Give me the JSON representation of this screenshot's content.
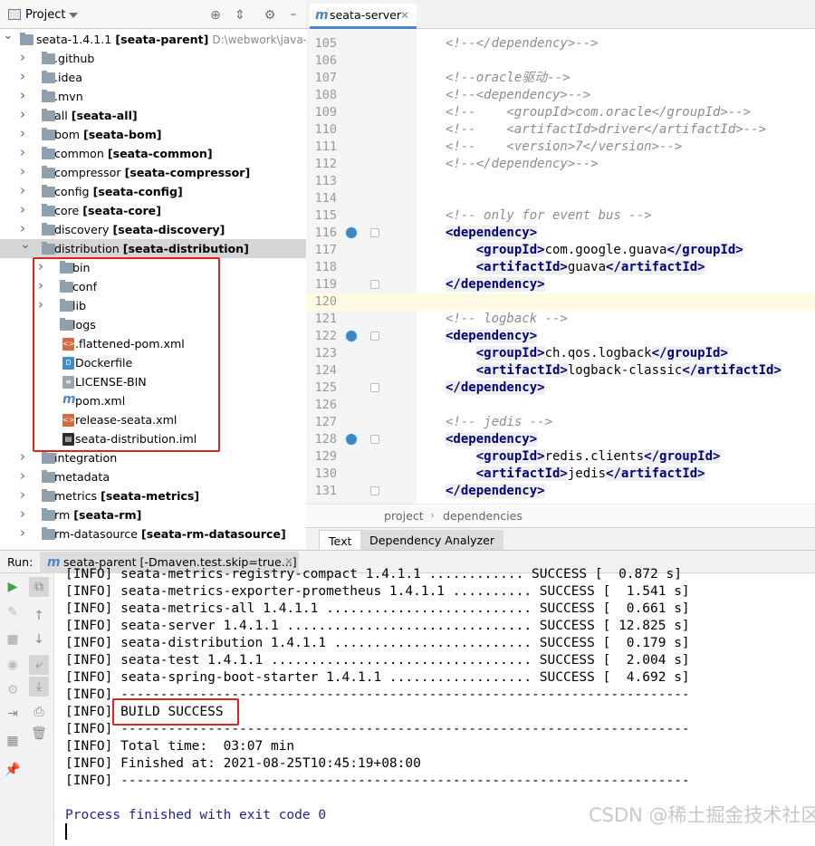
{
  "project": {
    "title": "Project",
    "root": {
      "name": "seata-1.4.1.1",
      "module": "[seata-parent]",
      "path": "D:\\webwork\\java-proj"
    },
    "items": [
      {
        "name": ".github",
        "module": ""
      },
      {
        "name": ".idea",
        "module": ""
      },
      {
        "name": ".mvn",
        "module": ""
      },
      {
        "name": "all",
        "module": "[seata-all]"
      },
      {
        "name": "bom",
        "module": "[seata-bom]"
      },
      {
        "name": "common",
        "module": "[seata-common]"
      },
      {
        "name": "compressor",
        "module": "[seata-compressor]"
      },
      {
        "name": "config",
        "module": "[seata-config]"
      },
      {
        "name": "core",
        "module": "[seata-core]"
      },
      {
        "name": "discovery",
        "module": "[seata-discovery]"
      },
      {
        "name": "distribution",
        "module": "[seata-distribution]"
      }
    ],
    "children": [
      {
        "name": "bin",
        "kind": "folder"
      },
      {
        "name": "conf",
        "kind": "folder"
      },
      {
        "name": "lib",
        "kind": "folder"
      },
      {
        "name": "logs",
        "kind": "folder"
      },
      {
        "name": ".flattened-pom.xml",
        "kind": "xml"
      },
      {
        "name": "Dockerfile",
        "kind": "docker"
      },
      {
        "name": "LICENSE-BIN",
        "kind": "text"
      },
      {
        "name": "pom.xml",
        "kind": "maven"
      },
      {
        "name": "release-seata.xml",
        "kind": "xml"
      },
      {
        "name": "seata-distribution.iml",
        "kind": "iml"
      }
    ],
    "after": [
      {
        "name": "integration",
        "module": ""
      },
      {
        "name": "metadata",
        "module": ""
      },
      {
        "name": "metrics",
        "module": "[seata-metrics]"
      },
      {
        "name": "rm",
        "module": "[seata-rm]"
      },
      {
        "name": "rm-datasource",
        "module": "[seata-rm-datasource]"
      }
    ]
  },
  "editor": {
    "tab": "seata-server",
    "tab_icon": "m",
    "lines": [
      {
        "n": "105",
        "t": "<!--</dependency>-->",
        "k": "cm"
      },
      {
        "n": "106",
        "t": "",
        "k": "cm"
      },
      {
        "n": "107",
        "t": "<!--oracle驱动-->",
        "k": "cm"
      },
      {
        "n": "108",
        "t": "<!--<dependency>-->",
        "k": "cm"
      },
      {
        "n": "109",
        "t": "<!--    <groupId>com.oracle</groupId>-->",
        "k": "cm"
      },
      {
        "n": "110",
        "t": "<!--    <artifactId>driver</artifactId>-->",
        "k": "cm"
      },
      {
        "n": "111",
        "t": "<!--    <version>7</version>-->",
        "k": "cm"
      },
      {
        "n": "112",
        "t": "<!--</dependency>-->",
        "k": "cm"
      },
      {
        "n": "113",
        "t": "",
        "k": "cm"
      },
      {
        "n": "114",
        "t": "",
        "k": "cm"
      },
      {
        "n": "115",
        "t": "<!-- only for event bus -->",
        "k": "cm"
      },
      {
        "n": "116",
        "t": "",
        "k": "dep-open"
      },
      {
        "n": "117",
        "t": "com.google.guava",
        "k": "groupId"
      },
      {
        "n": "118",
        "t": "guava",
        "k": "artifactId"
      },
      {
        "n": "119",
        "t": "",
        "k": "dep-close"
      },
      {
        "n": "120",
        "t": "",
        "k": "blank"
      },
      {
        "n": "121",
        "t": "<!-- logback -->",
        "k": "cm"
      },
      {
        "n": "122",
        "t": "",
        "k": "dep-open"
      },
      {
        "n": "123",
        "t": "ch.qos.logback",
        "k": "groupId"
      },
      {
        "n": "124",
        "t": "logback-classic",
        "k": "artifactId"
      },
      {
        "n": "125",
        "t": "",
        "k": "dep-close"
      },
      {
        "n": "126",
        "t": "",
        "k": "blank"
      },
      {
        "n": "127",
        "t": "<!-- jedis -->",
        "k": "cm"
      },
      {
        "n": "128",
        "t": "",
        "k": "dep-open"
      },
      {
        "n": "129",
        "t": "redis.clients",
        "k": "groupId"
      },
      {
        "n": "130",
        "t": "jedis",
        "k": "artifactId"
      },
      {
        "n": "131",
        "t": "",
        "k": "dep-close"
      }
    ],
    "breadcrumb": [
      "project",
      "dependencies"
    ],
    "bottom_tabs": [
      "Text",
      "Dependency Analyzer"
    ]
  },
  "run": {
    "label": "Run:",
    "tab": "seata-parent [-Dmaven.test.skip=true...]",
    "tab_icon": "m",
    "lines": [
      "[INFO] seata-metrics-registry-compact 1.4.1.1 ............ SUCCESS [  0.872 s]",
      "[INFO] seata-metrics-exporter-prometheus 1.4.1.1 .......... SUCCESS [  1.541 s]",
      "[INFO] seata-metrics-all 1.4.1.1 .......................... SUCCESS [  0.661 s]",
      "[INFO] seata-server 1.4.1.1 ............................... SUCCESS [ 12.825 s]",
      "[INFO] seata-distribution 1.4.1.1 ......................... SUCCESS [  0.179 s]",
      "[INFO] seata-test 1.4.1.1 ................................. SUCCESS [  2.004 s]",
      "[INFO] seata-spring-boot-starter 1.4.1.1 .................. SUCCESS [  4.692 s]",
      "[INFO] ------------------------------------------------------------------------",
      "[INFO] BUILD SUCCESS",
      "[INFO] ------------------------------------------------------------------------",
      "[INFO] Total time:  03:07 min",
      "[INFO] Finished at: 2021-08-25T10:45:19+08:00",
      "[INFO] ------------------------------------------------------------------------"
    ],
    "exit": "Process finished with exit code 0"
  },
  "watermark": "CSDN @稀土掘金技术社区"
}
